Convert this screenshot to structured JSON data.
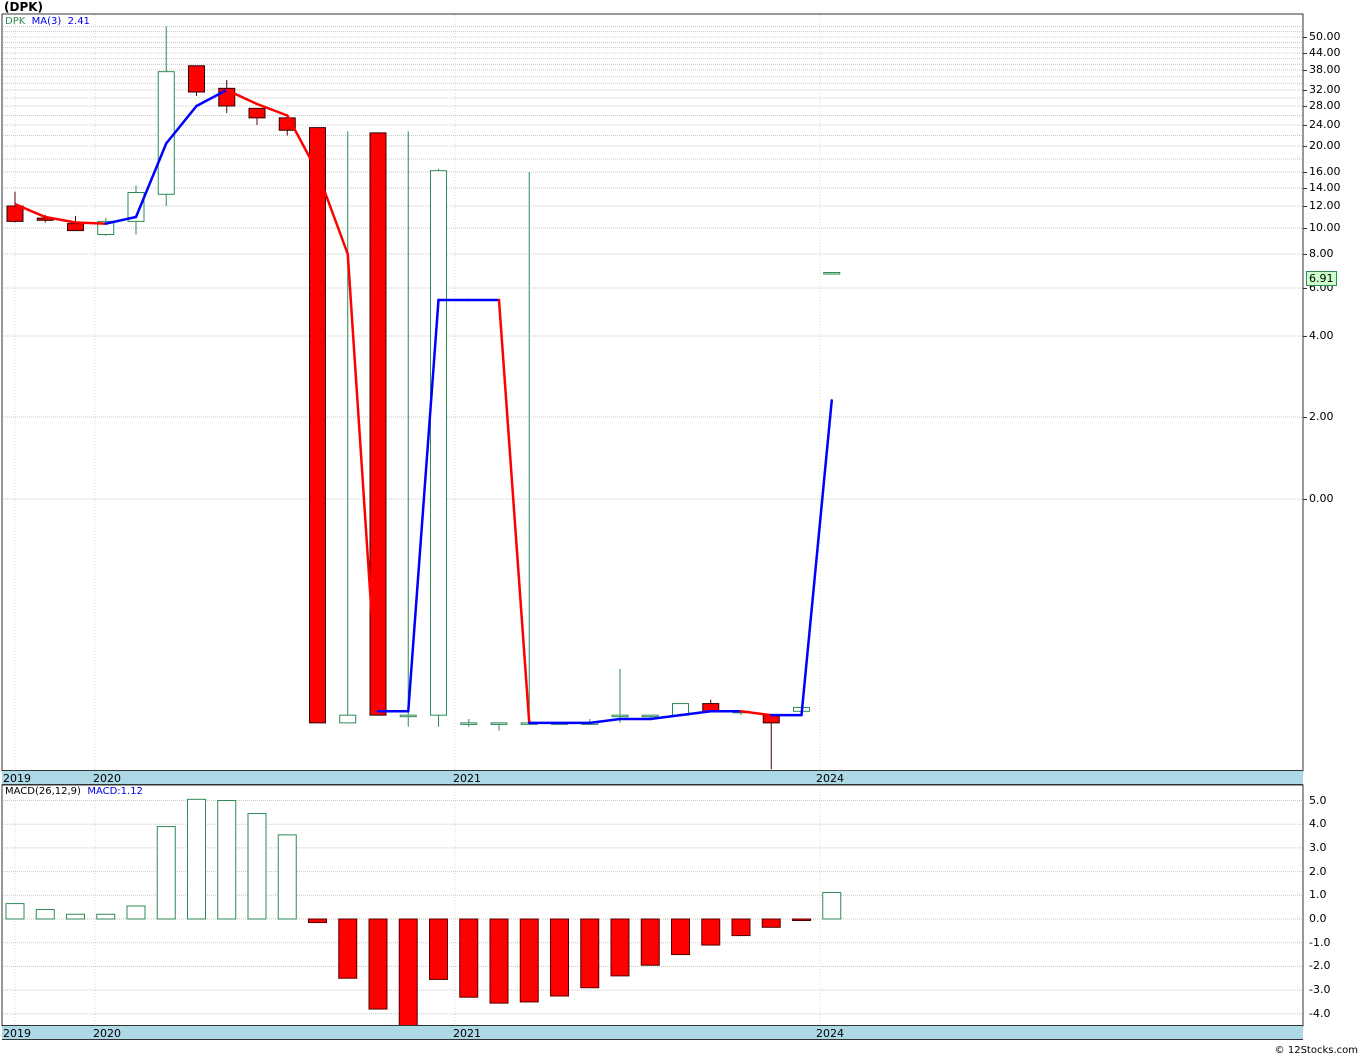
{
  "title": "(DPK)",
  "price_legend": {
    "symbol": "DPK",
    "ma_label": "MA(3)",
    "ma_value": "2.41"
  },
  "macd_legend": {
    "label": "MACD(26,12,9)",
    "value": "MACD:1.12"
  },
  "last_price": "6.91",
  "credit": "© 12Stocks.com",
  "x_axis_labels": [
    "2019",
    "2020",
    "2021",
    "2024"
  ],
  "price_axis_labels": [
    "50.00",
    "44.00",
    "38.00",
    "32.00",
    "28.00",
    "24.00",
    "20.00",
    "16.00",
    "14.00",
    "12.00",
    "10.00",
    "8.00",
    "6.00",
    "4.00",
    "2.00",
    "0.00"
  ],
  "macd_axis_labels": [
    "5.0",
    "4.0",
    "3.0",
    "2.0",
    "1.0",
    "0.0",
    "-1.0",
    "-2.0",
    "-3.0",
    "-4.0"
  ],
  "colors": {
    "up": "#2e8b57",
    "down": "#ff0000",
    "ma_up": "#0000ff",
    "ma_down": "#ff0000",
    "axis_band": "#add8e6"
  },
  "chart_data": [
    {
      "type": "candlestick",
      "title": "(DPK)",
      "series_name": "DPK",
      "candles": [
        {
          "o": 12.0,
          "h": 13.6,
          "l": 10.5,
          "c": 10.6
        },
        {
          "o": 10.9,
          "h": 11.2,
          "l": 10.5,
          "c": 10.7
        },
        {
          "o": 10.4,
          "h": 11.1,
          "l": 9.8,
          "c": 9.8
        },
        {
          "o": 9.5,
          "h": 10.9,
          "l": 9.4,
          "c": 10.6
        },
        {
          "o": 10.6,
          "h": 14.3,
          "l": 9.5,
          "c": 13.5
        },
        {
          "o": 13.3,
          "h": 54.0,
          "l": 12.0,
          "c": 37.5
        },
        {
          "o": 39.5,
          "h": 39.5,
          "l": 30.5,
          "c": 31.5
        },
        {
          "o": 32.5,
          "h": 35.0,
          "l": 26.5,
          "c": 28.0
        },
        {
          "o": 27.5,
          "h": 27.5,
          "l": 24.0,
          "c": 25.5
        },
        {
          "o": 25.5,
          "h": 25.5,
          "l": 22.0,
          "c": 23.0
        },
        {
          "o": 23.5,
          "h": 23.5,
          "l": -5.8,
          "c": -5.8
        },
        {
          "o": -5.8,
          "h": 22.8,
          "l": -5.8,
          "c": -5.6
        },
        {
          "o": 22.5,
          "h": 22.5,
          "l": -5.6,
          "c": -5.6
        },
        {
          "o": -5.6,
          "h": 22.8,
          "l": -5.9,
          "c": -5.6
        },
        {
          "o": -5.6,
          "h": 16.5,
          "l": -5.9,
          "c": 16.2
        },
        {
          "o": -5.8,
          "h": -5.7,
          "l": -5.9,
          "c": -5.8
        },
        {
          "o": -5.8,
          "h": -5.8,
          "l": -6.0,
          "c": -5.8
        },
        {
          "o": -5.8,
          "h": 16.0,
          "l": -5.8,
          "c": -5.8
        },
        {
          "o": -5.8,
          "h": -5.8,
          "l": -5.8,
          "c": -5.8
        },
        {
          "o": -5.8,
          "h": -5.7,
          "l": -5.8,
          "c": -5.8
        },
        {
          "o": -5.6,
          "h": -4.4,
          "l": -5.8,
          "c": -5.6
        },
        {
          "o": -5.6,
          "h": -5.6,
          "l": -5.7,
          "c": -5.6
        },
        {
          "o": -5.6,
          "h": -5.3,
          "l": -5.6,
          "c": -5.3
        },
        {
          "o": -5.3,
          "h": -5.2,
          "l": -5.5,
          "c": -5.5
        },
        {
          "o": -5.5,
          "h": -5.5,
          "l": -5.6,
          "c": -5.5
        },
        {
          "o": -5.6,
          "h": -5.6,
          "l": -7.0,
          "c": -5.8
        },
        {
          "o": -5.5,
          "h": -5.4,
          "l": -5.5,
          "c": -5.4
        },
        {
          "o": 6.91,
          "h": 6.91,
          "l": 6.91,
          "c": 6.91
        }
      ],
      "ma": [
        null,
        null,
        10.5,
        10.4,
        11.0,
        20.5,
        28.0,
        32.0,
        28.5,
        26.0,
        16.0,
        8.0,
        -5.5,
        -5.5,
        5.5,
        5.5,
        5.5,
        -5.8,
        -5.8,
        -5.8,
        -5.7,
        -5.7,
        -5.6,
        -5.5,
        -5.5,
        -5.6,
        -5.6,
        2.41
      ],
      "ymin": -7.0,
      "ymax": 55.0,
      "grid": true
    },
    {
      "type": "bar",
      "title": "MACD(26,12,9)",
      "values": [
        0.65,
        0.4,
        0.2,
        0.2,
        0.55,
        3.9,
        5.05,
        5.0,
        4.45,
        3.55,
        -0.15,
        -2.5,
        -3.8,
        -4.5,
        -2.55,
        -3.3,
        -3.55,
        -3.5,
        -3.25,
        -2.9,
        -2.4,
        -1.95,
        -1.5,
        -1.1,
        -0.7,
        -0.35,
        -0.05,
        1.12
      ],
      "ylim": [
        -4.5,
        5.3
      ],
      "grid": true
    }
  ]
}
